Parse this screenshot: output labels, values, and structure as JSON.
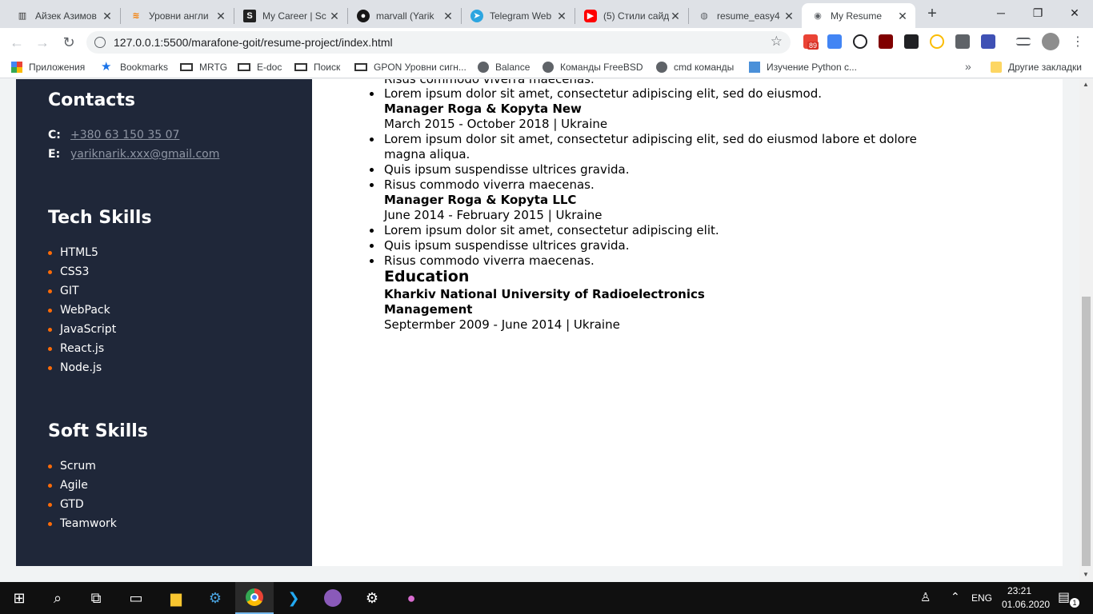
{
  "browser": {
    "tabs": [
      {
        "title": "Айзек Азимов",
        "icon": "building-icon",
        "color": "#333333"
      },
      {
        "title": "Уровни англи",
        "icon": "wifi-icon",
        "color": "#f57c00"
      },
      {
        "title": "My Career | Sc",
        "icon": "s-logo-icon",
        "color": "#222222"
      },
      {
        "title": "marvall (Yarik",
        "icon": "github-icon",
        "color": "#181717"
      },
      {
        "title": "Telegram Web",
        "icon": "telegram-icon",
        "color": "#2ca5e0"
      },
      {
        "title": "(5) Стили сайд",
        "icon": "youtube-icon",
        "color": "#ff0000"
      },
      {
        "title": "resume_easy4",
        "icon": "drop-icon",
        "color": "#5f6368"
      },
      {
        "title": "My Resume",
        "icon": "globe-icon",
        "color": "#5f6368"
      }
    ],
    "url": "127.0.0.1:5500/marafone-goit/resume-project/index.html",
    "gmail_badge": "89",
    "bookmarks": [
      {
        "label": "Приложения",
        "icon": "apps-icon"
      },
      {
        "label": "Bookmarks",
        "icon": "star-icon"
      },
      {
        "label": "MRTG",
        "icon": "router-icon"
      },
      {
        "label": "E-doc",
        "icon": "router-icon"
      },
      {
        "label": "Поиск",
        "icon": "router-icon"
      },
      {
        "label": "GPON Уровни сигн...",
        "icon": "router-icon"
      },
      {
        "label": "Balance",
        "icon": "globe-icon"
      },
      {
        "label": "Команды FreeBSD",
        "icon": "globe-icon"
      },
      {
        "label": "cmd команды",
        "icon": "globe-icon"
      },
      {
        "label": "Изучение Python с...",
        "icon": "puzzle-icon"
      }
    ],
    "more": "»",
    "other_bookmarks": "Другие закладки"
  },
  "sidebar": {
    "contacts_title": "Contacts",
    "phone_label": "C:",
    "phone": "+380 63 150 35 07",
    "email_label": "E:",
    "email": "yariknarik.xxx@gmail.com",
    "tech_title": "Tech Skills",
    "tech_skills": [
      "HTML5",
      "CSS3",
      "GIT",
      "WebPack",
      "JavaScript",
      "React.js",
      "Node.js"
    ],
    "soft_title": "Soft Skills",
    "soft_skills": [
      "Scrum",
      "Agile",
      "GTD",
      "Teamwork"
    ]
  },
  "main": {
    "cut_line": "Risus commodo viverra maecenas.",
    "job1_bullet": "Lorem ipsum dolor sit amet, consectetur adipiscing elit, sed do eiusmod.",
    "job2_title": "Manager Roga & Kopyta New",
    "job2_dates": "March 2015 - October 2018 | Ukraine",
    "job2_b1_l1": "Lorem ipsum dolor sit amet, consectetur adipiscing elit, sed do eiusmod labore et dolore",
    "job2_b1_l2": "magna aliqua.",
    "job2_b2": "Quis ipsum suspendisse ultrices gravida.",
    "job2_b3": "Risus commodo viverra maecenas.",
    "job3_title": "Manager Roga & Kopyta LLC",
    "job3_dates": "June 2014 - February 2015 | Ukraine",
    "job3_b1": "Lorem ipsum dolor sit amet, consectetur adipiscing elit.",
    "job3_b2": "Quis ipsum suspendisse ultrices gravida.",
    "job3_b3": "Risus commodo viverra maecenas.",
    "education_title": "Education",
    "edu_school": "Kharkiv National University of Radioelectronics",
    "edu_field": "Management",
    "edu_dates": "Septermber 2009 - June 2014 | Ukraine"
  },
  "taskbar": {
    "language": "ENG",
    "time": "23:21",
    "date": "01.06.2020",
    "notifications": "1"
  }
}
